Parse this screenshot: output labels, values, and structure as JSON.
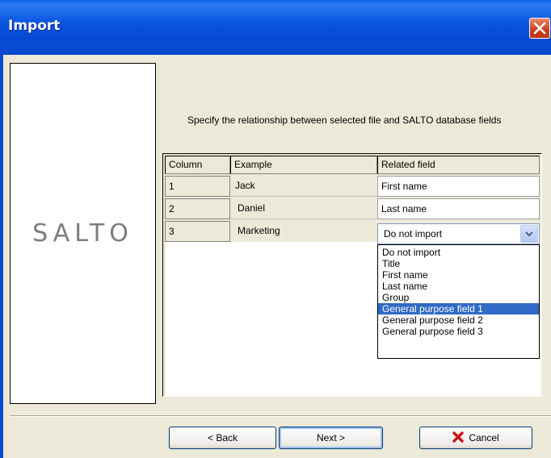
{
  "window": {
    "title": "Import"
  },
  "logo": {
    "text": "SALTO"
  },
  "instruction": "Specify the relationship between selected file and SALTO database fields",
  "table": {
    "headers": [
      "Column",
      "Example",
      "Related field"
    ],
    "rows": [
      {
        "column": "1",
        "example": "Jack",
        "related": "First name"
      },
      {
        "column": "2",
        "example": "Daniel",
        "related": "Last name"
      },
      {
        "column": "3",
        "example": "Marketing",
        "related": "Do not import"
      }
    ]
  },
  "dropdown": {
    "options": [
      "Do not import",
      "Title",
      "First name",
      "Last name",
      "Group",
      "General purpose field 1",
      "General purpose field 2",
      "General purpose field 3"
    ],
    "highlighted": "General purpose field 1"
  },
  "buttons": {
    "back": "< Back",
    "next": "Next >",
    "cancel": "Cancel"
  },
  "colors": {
    "titlebar": "#0a56e0",
    "highlight": "#316ac5",
    "close": "#c8411a",
    "cancel_icon": "#c81414"
  }
}
